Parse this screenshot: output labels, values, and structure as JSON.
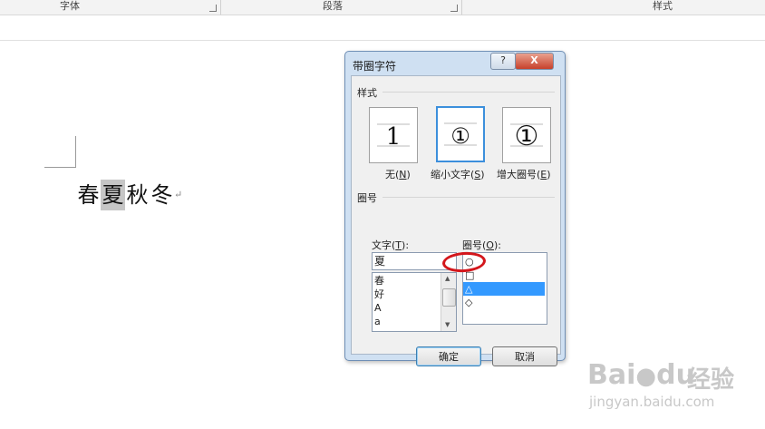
{
  "ribbon": {
    "groups": [
      {
        "label": "字体"
      },
      {
        "label": "段落"
      },
      {
        "label": "样式"
      }
    ]
  },
  "document": {
    "chars": [
      "春",
      "夏",
      "秋",
      "冬"
    ],
    "selected_index": 1,
    "paragraph_mark": "↵"
  },
  "dialog": {
    "title": "带圈字符",
    "help_button": "?",
    "close_button": "X",
    "style_section": "样式",
    "style_options": [
      {
        "label": "无",
        "key": "N",
        "glyph": "1",
        "selected": false
      },
      {
        "label": "缩小文字",
        "key": "S",
        "glyph": "①",
        "selected": true
      },
      {
        "label": "增大圈号",
        "key": "E",
        "glyph": "①",
        "selected": false
      }
    ],
    "circle_section": "圈号",
    "text_field_label": "文字",
    "text_field_key": "T",
    "text_value": "夏",
    "text_list": [
      "春",
      "好",
      "A",
      "a"
    ],
    "circle_field_label": "圈号",
    "circle_field_key": "O",
    "circle_list": [
      "○",
      "□",
      "△",
      "◇"
    ],
    "circle_selected_index": 2,
    "ok_button": "确定",
    "cancel_button": "取消"
  },
  "watermark": {
    "brand": "Bai",
    "brand2": "du",
    "brand_cn": "经验",
    "url": "jingyan.baidu.com"
  }
}
